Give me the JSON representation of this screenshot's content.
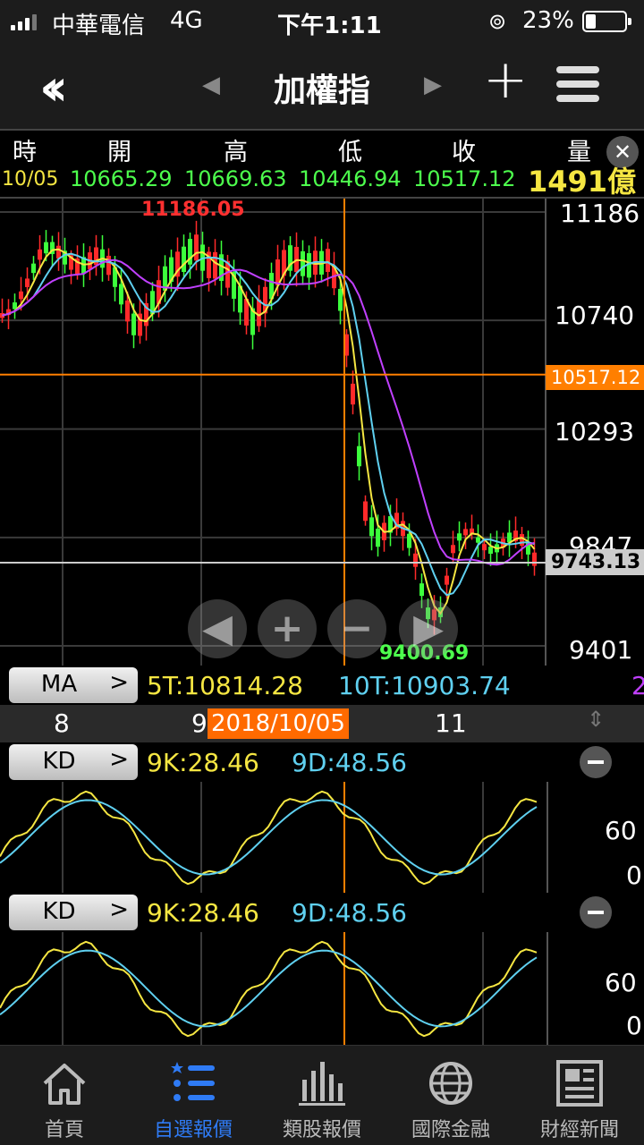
{
  "status": {
    "carrier": "中華電信",
    "network": "4G",
    "time": "下午1:11",
    "battery": "23%"
  },
  "nav": {
    "title": "加權指"
  },
  "quote": {
    "headers": [
      "時",
      "開",
      "高",
      "低",
      "收",
      "量"
    ],
    "date": "10/05",
    "open": "10665.29",
    "high": "10669.63",
    "low": "10446.94",
    "close": "10517.12",
    "volume": "1491億"
  },
  "main": {
    "high_label": "11186.05",
    "low_label": "9400.69",
    "y_ticks": [
      "11186",
      "10740",
      "10293",
      "9847",
      "9401"
    ],
    "cursor_price": "10517.12",
    "last_price": "9743.13"
  },
  "ma": {
    "button": "MA",
    "t5": "5T:10814.28",
    "t10": "10T:10903.74",
    "t20": "2"
  },
  "timeline": {
    "m8": "8",
    "m9": "9",
    "date": "2018/10/05",
    "m11": "11"
  },
  "kd1": {
    "button": "KD",
    "k": "9K:28.46",
    "d": "9D:48.56",
    "y_ticks": [
      "60",
      "0"
    ]
  },
  "kd2": {
    "button": "KD",
    "k": "9K:28.46",
    "d": "9D:48.56",
    "y_ticks": [
      "60",
      "0"
    ]
  },
  "tabs": [
    {
      "label": "首頁",
      "icon": "home-icon"
    },
    {
      "label": "自選報價",
      "icon": "list-icon"
    },
    {
      "label": "類股報價",
      "icon": "bars-icon"
    },
    {
      "label": "國際金融",
      "icon": "globe-icon"
    },
    {
      "label": "財經新聞",
      "icon": "news-icon"
    }
  ],
  "colors": {
    "up": "#ff2a2a",
    "down": "#3cff3c",
    "ma5": "#f5e642",
    "ma10": "#5fd0f0",
    "ma20": "#c040ff",
    "cursor": "#ff7f00",
    "accent": "#2f7bf5"
  },
  "chart_data": {
    "type": "candlestick",
    "series": [
      {
        "name": "5T",
        "values": [
          10814.28
        ]
      },
      {
        "name": "10T",
        "values": [
          10903.74
        ]
      }
    ],
    "ylim": [
      9401,
      11186
    ],
    "y_ticks": [
      11186,
      10740,
      10293,
      9847,
      9401
    ],
    "x_ticks": [
      "8",
      "9",
      "11"
    ],
    "high": 11186.05,
    "low": 9400.69,
    "last": 9743.13,
    "cursor": {
      "date": "2018/10/05",
      "price": 10517.12
    },
    "indicators": [
      {
        "type": "KD",
        "k": 28.46,
        "d": 48.56,
        "y_ticks": [
          60,
          0
        ]
      },
      {
        "type": "KD",
        "k": 28.46,
        "d": 48.56,
        "y_ticks": [
          60,
          0
        ]
      }
    ]
  }
}
